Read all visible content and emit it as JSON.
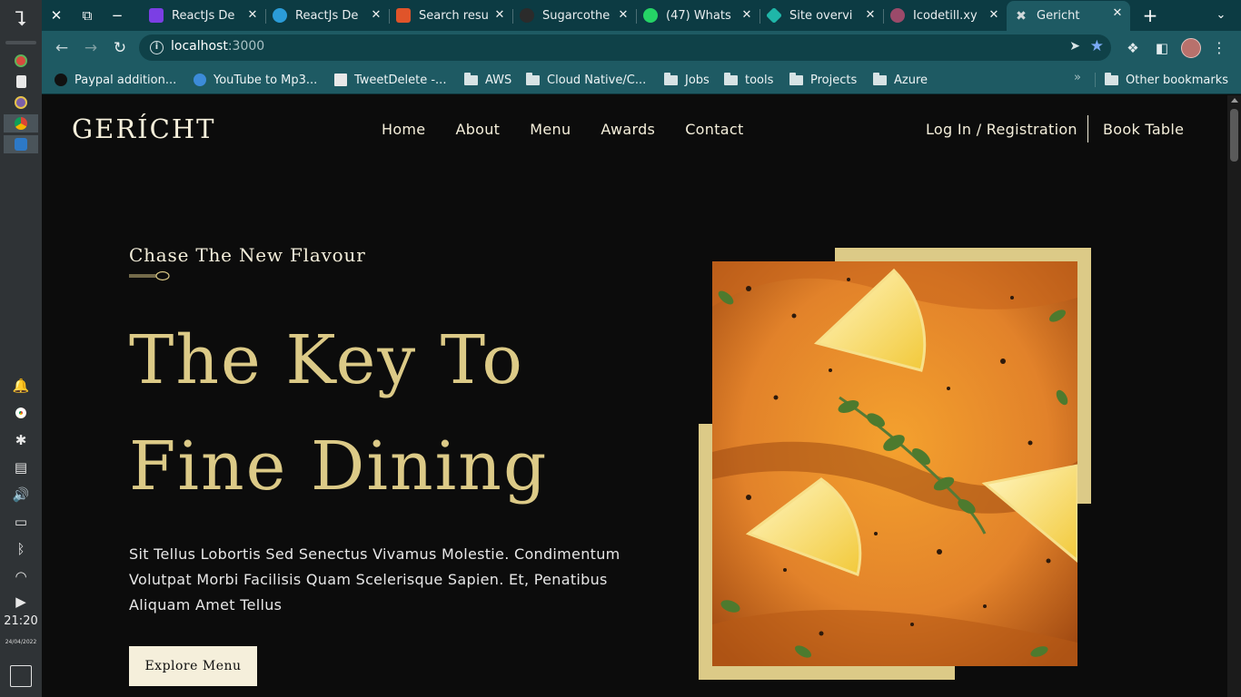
{
  "os": {
    "time": "21:20",
    "date": "24/04/2022"
  },
  "browser": {
    "tabs": [
      {
        "label": "ReactJs De",
        "icon": "purple-arrow-icon",
        "color": "#7b3fe4"
      },
      {
        "label": "ReactJs De",
        "icon": "wp-logo-icon",
        "color": "#2b9cd8"
      },
      {
        "label": "Search resu",
        "icon": "stack-logo-icon",
        "color": "#e0542a"
      },
      {
        "label": "Sugarcothe",
        "icon": "github-icon",
        "color": "#2b2b2b"
      },
      {
        "label": "(47) Whats",
        "icon": "whatsapp-icon",
        "color": "#25d366"
      },
      {
        "label": "Site overvi",
        "icon": "netlify-icon",
        "color": "#1fb6a8"
      },
      {
        "label": "Icodetill.xy",
        "icon": "avatar-icon",
        "color": "#9b4a6a"
      },
      {
        "label": "Gericht",
        "icon": "fork-knife-icon",
        "color": "#d0d8da"
      }
    ],
    "url_host": "localhost",
    "url_port": ":3000",
    "bookmarks": [
      {
        "label": "Paypal addition...",
        "type": "link"
      },
      {
        "label": "YouTube to Mp3...",
        "type": "link"
      },
      {
        "label": "TweetDelete -...",
        "type": "link"
      },
      {
        "label": "AWS",
        "type": "folder"
      },
      {
        "label": "Cloud Native/C...",
        "type": "folder"
      },
      {
        "label": "Jobs",
        "type": "folder"
      },
      {
        "label": "tools",
        "type": "folder"
      },
      {
        "label": "Projects",
        "type": "folder"
      },
      {
        "label": "Azure",
        "type": "folder"
      }
    ],
    "bookmarks_more": "»",
    "other_bookmarks": "Other bookmarks"
  },
  "site": {
    "logo": "GERÍCHT",
    "nav": [
      "Home",
      "About",
      "Menu",
      "Awards",
      "Contact"
    ],
    "login": "Log In / Registration",
    "book_table": "Book Table",
    "subtitle": "Chase The New Flavour",
    "headline_line1": "The Key To",
    "headline_line2": "Fine Dining",
    "paragraph": "Sit Tellus Lobortis Sed Senectus Vivamus Molestie. Condimentum Volutpat Morbi Facilisis Quam Scelerisque Sapien. Et, Penatibus Aliquam Amet Tellus",
    "cta": "Explore Menu",
    "colors": {
      "golden": "#dcca87",
      "black": "#0c0c0c",
      "white": "#f5efdb"
    }
  }
}
